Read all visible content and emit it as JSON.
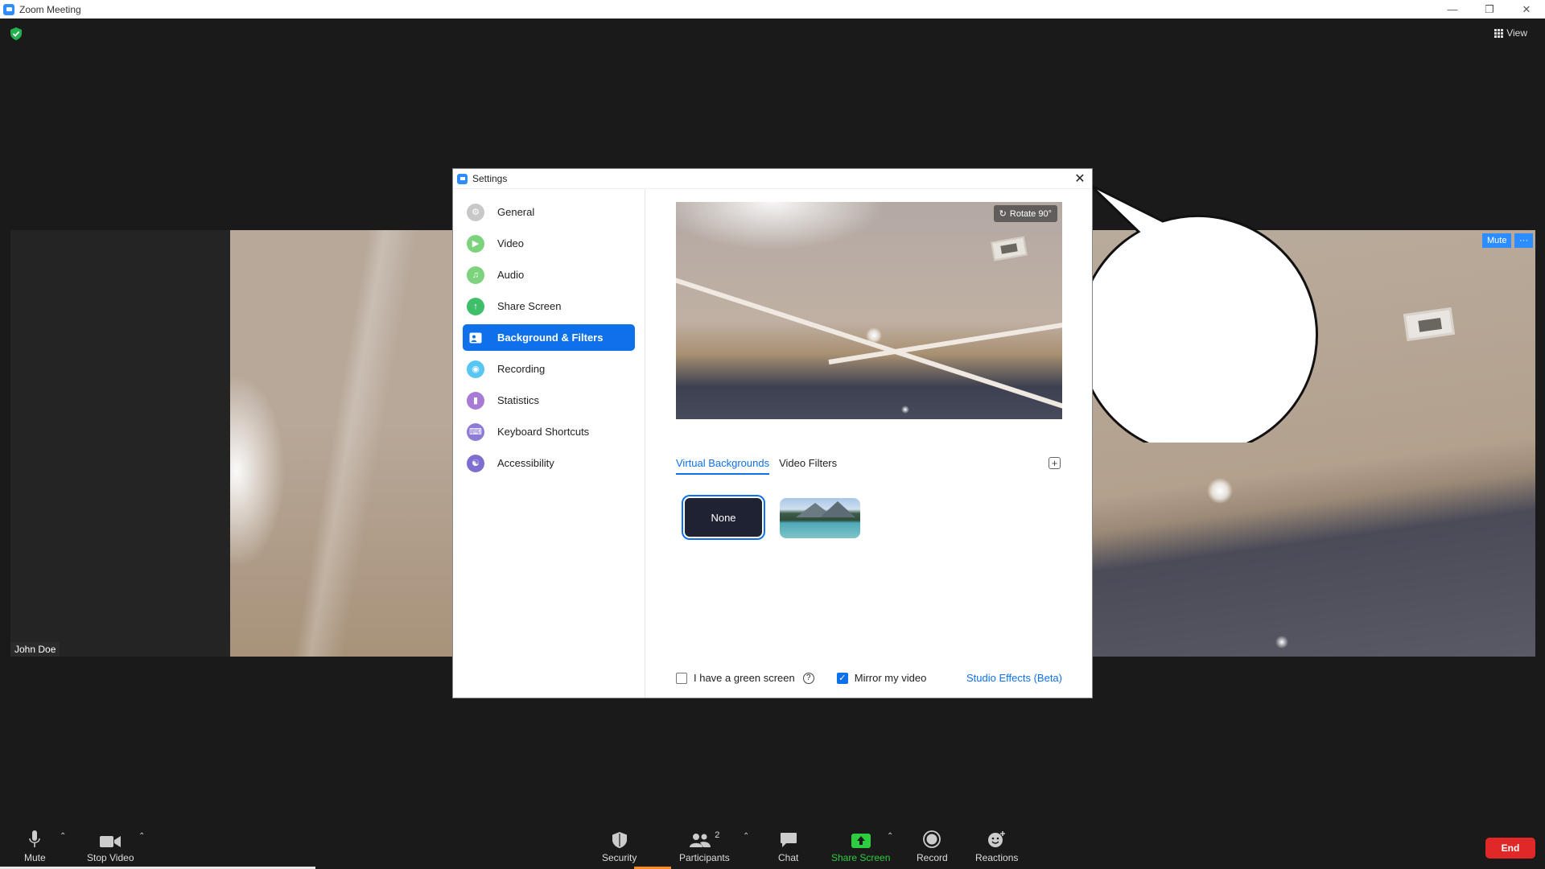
{
  "window": {
    "title": "Zoom Meeting"
  },
  "meeting": {
    "view_label": "View",
    "participant_name": "John Doe",
    "tile_mute_label": "Mute",
    "tile_more_label": "···"
  },
  "settings": {
    "title": "Settings",
    "nav": [
      {
        "label": "General",
        "icon": "gear-icon",
        "color": "#c8c8c8"
      },
      {
        "label": "Video",
        "icon": "video-camera-icon",
        "color": "#7dd37d"
      },
      {
        "label": "Audio",
        "icon": "headphones-icon",
        "color": "#7dd37d"
      },
      {
        "label": "Share Screen",
        "icon": "share-screen-icon",
        "color": "#3fbf6a"
      },
      {
        "label": "Background & Filters",
        "icon": "person-background-icon",
        "color": "#0e71eb"
      },
      {
        "label": "Recording",
        "icon": "record-icon",
        "color": "#58c6f2"
      },
      {
        "label": "Statistics",
        "icon": "bar-chart-icon",
        "color": "#a77bd6"
      },
      {
        "label": "Keyboard Shortcuts",
        "icon": "keyboard-icon",
        "color": "#8e7bd6"
      },
      {
        "label": "Accessibility",
        "icon": "accessibility-icon",
        "color": "#7e6ed0"
      }
    ],
    "active_nav": "Background & Filters",
    "rotate_label": "Rotate 90°",
    "tabs": [
      {
        "label": "Virtual Backgrounds",
        "active": true
      },
      {
        "label": "Video Filters",
        "active": false
      }
    ],
    "backgrounds": [
      {
        "label": "None",
        "selected": true
      },
      {
        "label": "",
        "selected": false
      }
    ],
    "green_screen_label": "I have a green screen",
    "green_screen_checked": false,
    "mirror_label": "Mirror my video",
    "mirror_checked": true,
    "studio_effects_label": "Studio Effects (Beta)"
  },
  "toolbar": {
    "mute": "Mute",
    "stop_video": "Stop Video",
    "security": "Security",
    "participants": "Participants",
    "participants_count": "2",
    "chat": "Chat",
    "share_screen": "Share Screen",
    "record": "Record",
    "reactions": "Reactions",
    "end": "End"
  },
  "colors": {
    "accent": "#0e71eb",
    "end_red": "#e02828",
    "share_green": "#2ecc40"
  }
}
